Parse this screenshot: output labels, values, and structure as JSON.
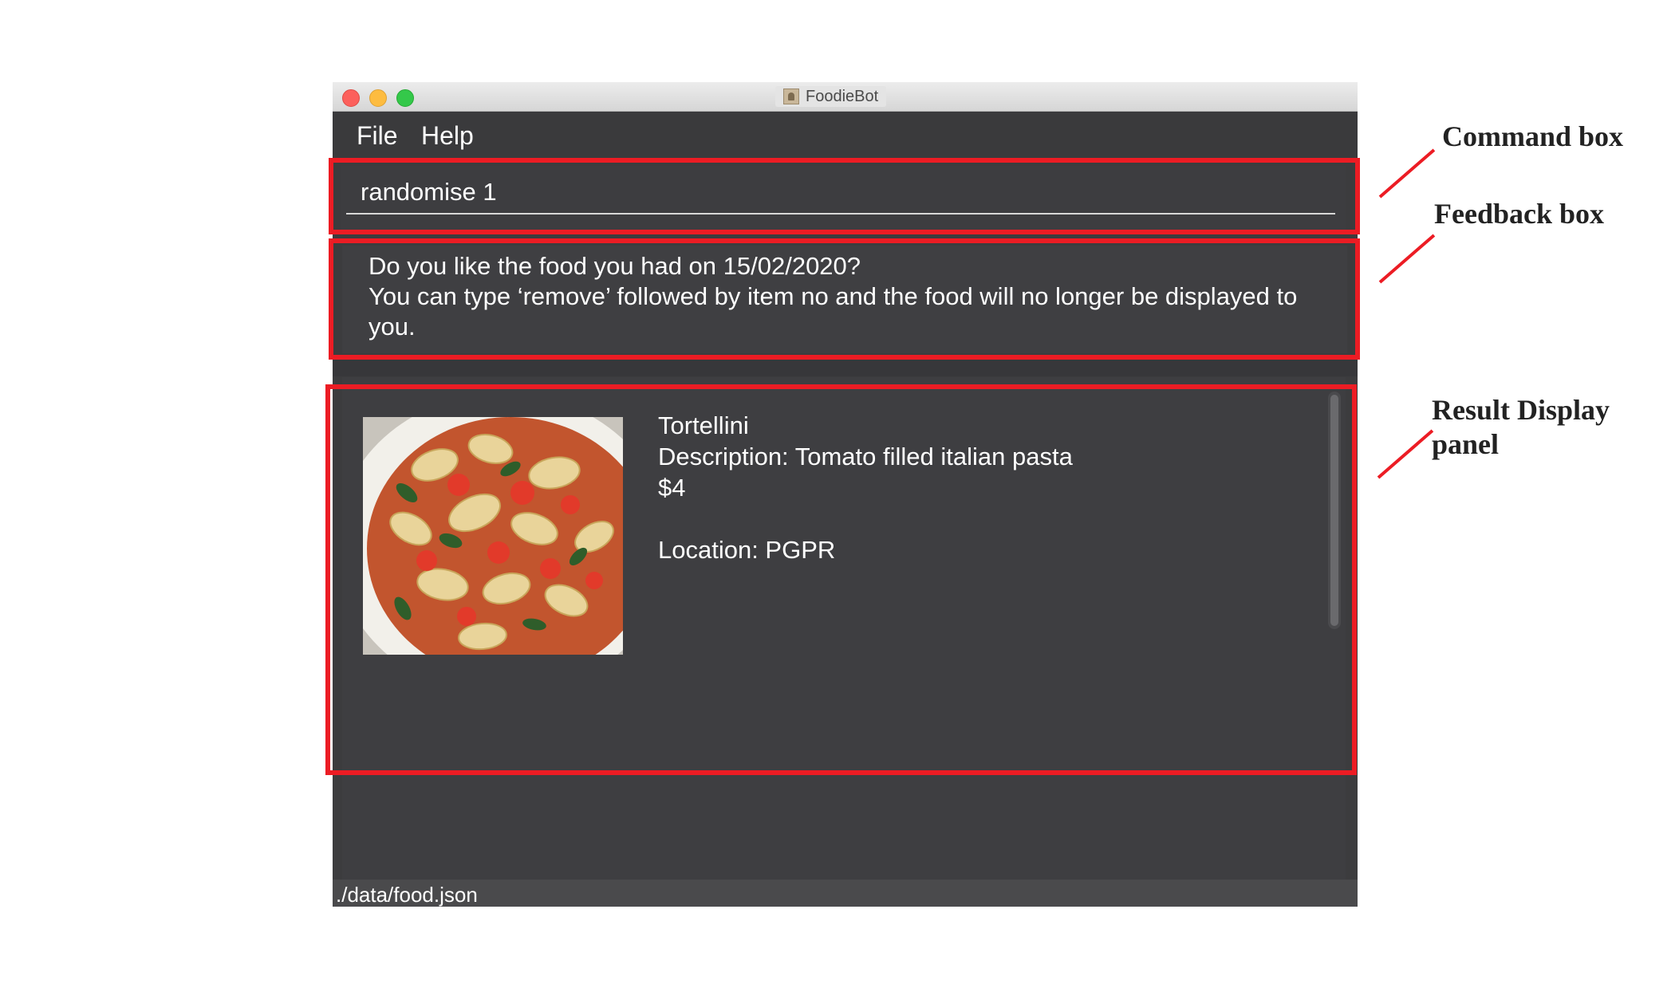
{
  "window": {
    "title": "FoodieBot"
  },
  "menu": {
    "items": [
      "File",
      "Help"
    ]
  },
  "command_box": {
    "value": "randomise 1"
  },
  "feedback": {
    "lines": [
      "Do you like the food you had on 15/02/2020?",
      "You can type ‘remove’  followed by item no and the food will no longer be displayed to",
      "you."
    ]
  },
  "result": {
    "name": "Tortellini",
    "description": "Description: Tomato filled italian pasta",
    "price": "$4",
    "location": "Location: PGPR",
    "image": "tortellini-dish-photo"
  },
  "status_bar": {
    "path": "./data/food.json"
  },
  "annotations": {
    "command_box": "Command box",
    "feedback_box": "Feedback box",
    "result_line1": "Result Display",
    "result_line2": "panel",
    "highlight_color": "#ec1c24"
  }
}
